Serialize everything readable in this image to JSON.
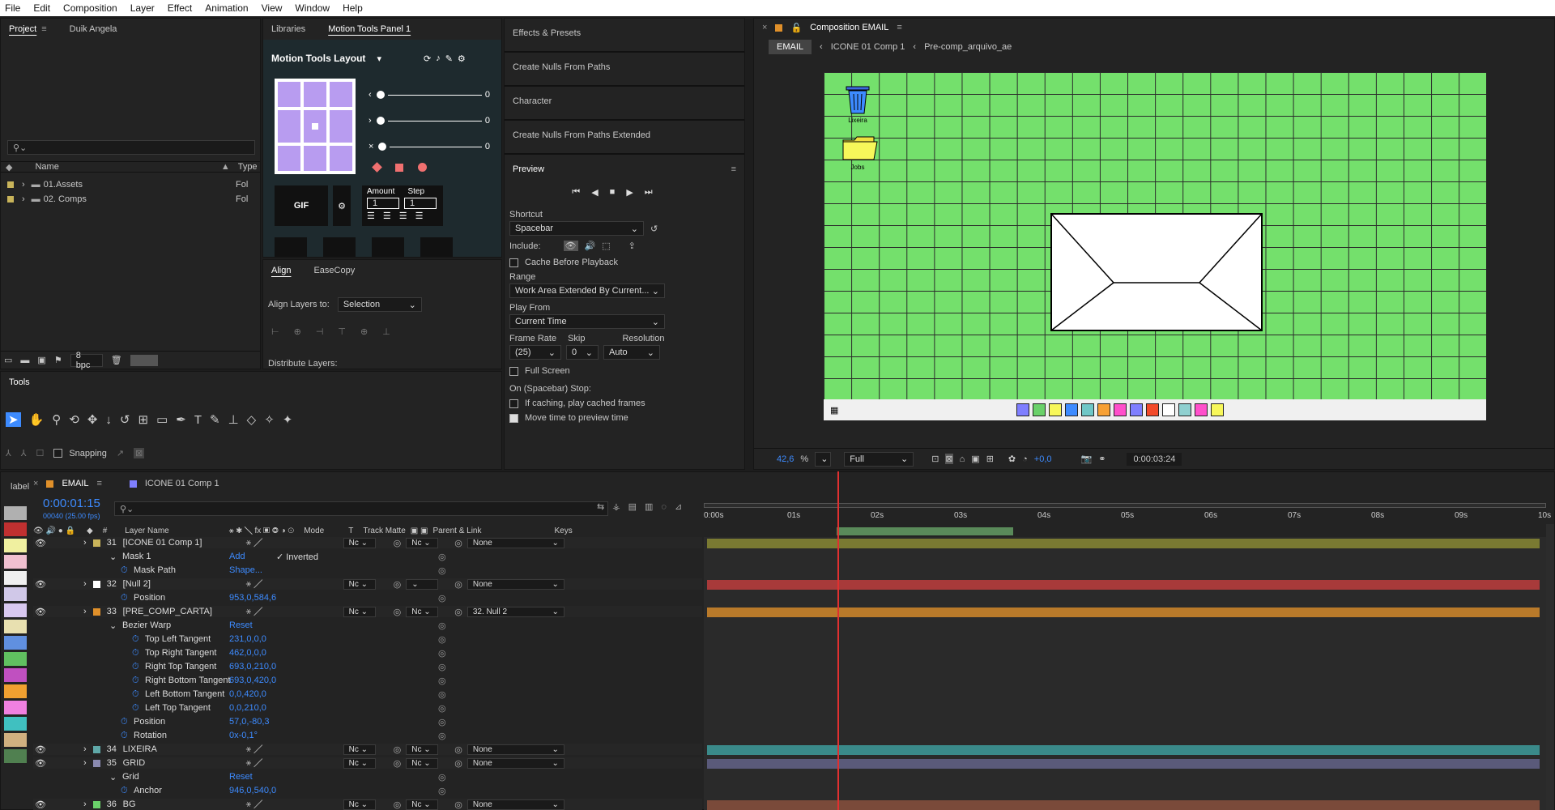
{
  "menu": [
    "File",
    "Edit",
    "Composition",
    "Layer",
    "Effect",
    "Animation",
    "View",
    "Window",
    "Help"
  ],
  "project_panel": {
    "tabs": [
      "Project",
      "Duik Angela"
    ],
    "search_placeholder": "",
    "col_name": "Name",
    "col_type": "Type",
    "items": [
      {
        "name": "01.Assets",
        "type": "Fol"
      },
      {
        "name": "02. Comps",
        "type": "Fol"
      }
    ],
    "bpc": "8 bpc"
  },
  "motion_tools": {
    "tabs": [
      "Libraries",
      "Motion Tools Panel 1"
    ],
    "title": "Motion Tools Layout",
    "sliders": [
      "0",
      "0",
      "0"
    ],
    "gif": "GIF",
    "amount_label": "Amount",
    "step_label": "Step",
    "amount": "1",
    "step": "1"
  },
  "align_panel": {
    "tabs": [
      "Align",
      "EaseCopy"
    ],
    "align_to_label": "Align Layers to:",
    "align_to_value": "Selection",
    "distribute": "Distribute Layers:"
  },
  "tools_panel": {
    "title": "Tools",
    "snapping": "Snapping"
  },
  "effects_panel": {
    "items": [
      "Effects & Presets",
      "Create Nulls From Paths",
      "Character",
      "Create Nulls From Paths Extended"
    ]
  },
  "preview_panel": {
    "title": "Preview",
    "shortcut_label": "Shortcut",
    "shortcut": "Spacebar",
    "include_label": "Include:",
    "cache_before": "Cache Before Playback",
    "range_label": "Range",
    "range": "Work Area Extended By Current...",
    "play_from_label": "Play From",
    "play_from": "Current Time",
    "frame_rate_label": "Frame Rate",
    "skip_label": "Skip",
    "resolution_label": "Resolution",
    "frame_rate": "(25)",
    "skip": "0",
    "resolution": "Auto",
    "full_screen": "Full Screen",
    "stop_label": "On (Spacebar) Stop:",
    "if_caching": "If caching, play cached frames",
    "move_time": "Move time to preview time"
  },
  "composition": {
    "title": "Composition EMAIL",
    "breadcrumbs": [
      "EMAIL",
      "ICONE 01 Comp 1",
      "Pre-comp_arquivo_ae"
    ],
    "icon_lixeira": "Lixeira",
    "icon_jobs": "Jobs",
    "zoom": "42,6",
    "zoom_unit": "%",
    "quality": "Full",
    "exposure": "+0,0",
    "timecode": "0:00:03:24",
    "bg_color": "#74e06c",
    "swatches": [
      "#7f7fff",
      "#6ad16a",
      "#f7f75a",
      "#3d8bff",
      "#6fc7c7",
      "#f7a034",
      "#ff4fcb",
      "#7f7fff",
      "#f24a2a",
      "#ffffff",
      "#8fd0d0",
      "#ff4fcb",
      "#f7f75a"
    ]
  },
  "timeline": {
    "label": "label",
    "tabs": [
      "EMAIL",
      "ICONE 01 Comp 1"
    ],
    "timecode": "0:00:01:15",
    "fps": "00040 (25.00 fps)",
    "headers": {
      "num": "#",
      "layer_name": "Layer Name",
      "mode": "Mode",
      "t": "T",
      "track_matte": "Track Matte",
      "parent": "Parent & Link",
      "keys": "Keys"
    },
    "ruler": [
      "0:00s",
      "01s",
      "02s",
      "03s",
      "04s",
      "05s",
      "06s",
      "07s",
      "08s",
      "09s",
      "10s"
    ],
    "rows": [
      {
        "type": "layer",
        "num": "31",
        "name": "[ICONE 01 Comp 1]",
        "mode": "Nc",
        "matte": "Nc",
        "parent": "None",
        "color": "#c9b45a",
        "bar": "#7a7a32"
      },
      {
        "type": "prop",
        "indent": 1,
        "name": "Mask 1",
        "value": "Add",
        "extra": "Inverted"
      },
      {
        "type": "prop",
        "indent": 2,
        "name": "Mask Path",
        "value": "Shape..."
      },
      {
        "type": "layer",
        "num": "32",
        "name": "[Null 2]",
        "mode": "Nc",
        "matte": "",
        "parent": "None",
        "color": "#ffffff",
        "bar": "#a83a3a"
      },
      {
        "type": "prop",
        "indent": 2,
        "name": "Position",
        "value": "953,0,584,6"
      },
      {
        "type": "layer",
        "num": "33",
        "name": "[PRE_COMP_CARTA]",
        "mode": "Nc",
        "matte": "Nc",
        "parent": "32. Null 2",
        "color": "#e0902a",
        "bar": "#b97a2a"
      },
      {
        "type": "prop",
        "indent": 1,
        "name": "Bezier Warp",
        "value": "Reset"
      },
      {
        "type": "prop",
        "indent": 3,
        "name": "Top Left Tangent",
        "value": "231,0,0,0"
      },
      {
        "type": "prop",
        "indent": 3,
        "name": "Top Right Tangent",
        "value": "462,0,0,0"
      },
      {
        "type": "prop",
        "indent": 3,
        "name": "Right Top Tangent",
        "value": "693,0,210,0"
      },
      {
        "type": "prop",
        "indent": 3,
        "name": "Right Bottom Tangent",
        "value": "693,0,420,0"
      },
      {
        "type": "prop",
        "indent": 3,
        "name": "Left Bottom Tangent",
        "value": "0,0,420,0"
      },
      {
        "type": "prop",
        "indent": 3,
        "name": "Left Top Tangent",
        "value": "0,0,210,0"
      },
      {
        "type": "prop",
        "indent": 2,
        "name": "Position",
        "value": "57,0,-80,3"
      },
      {
        "type": "prop",
        "indent": 2,
        "name": "Rotation",
        "value": "0x-0,1°"
      },
      {
        "type": "layer",
        "num": "34",
        "name": "LIXEIRA",
        "mode": "Nc",
        "matte": "Nc",
        "parent": "None",
        "color": "#5fa8a8",
        "bar": "#3a8a8a"
      },
      {
        "type": "layer",
        "num": "35",
        "name": "GRID",
        "mode": "Nc",
        "matte": "Nc",
        "parent": "None",
        "color": "#8a8ab0",
        "bar": "#5a5a7a"
      },
      {
        "type": "prop",
        "indent": 1,
        "name": "Grid",
        "value": "Reset"
      },
      {
        "type": "prop",
        "indent": 2,
        "name": "Anchor",
        "value": "946,0,540,0"
      },
      {
        "type": "layer",
        "num": "36",
        "name": "BG",
        "mode": "Nc",
        "matte": "Nc",
        "parent": "None",
        "color": "#6ad16a",
        "bar": "#7a4a3a"
      }
    ],
    "label_colors": [
      "#b0b0b0",
      "#c03030",
      "#f0f0a0",
      "#f0c0d0",
      "#f0f0f0",
      "#d0c8e8",
      "#d8c8f0",
      "#e8e0b0",
      "#6090e0",
      "#60c060",
      "#c050c0",
      "#f0a030",
      "#f080e0",
      "#40c0c0",
      "#d0b080",
      "#508050"
    ]
  }
}
